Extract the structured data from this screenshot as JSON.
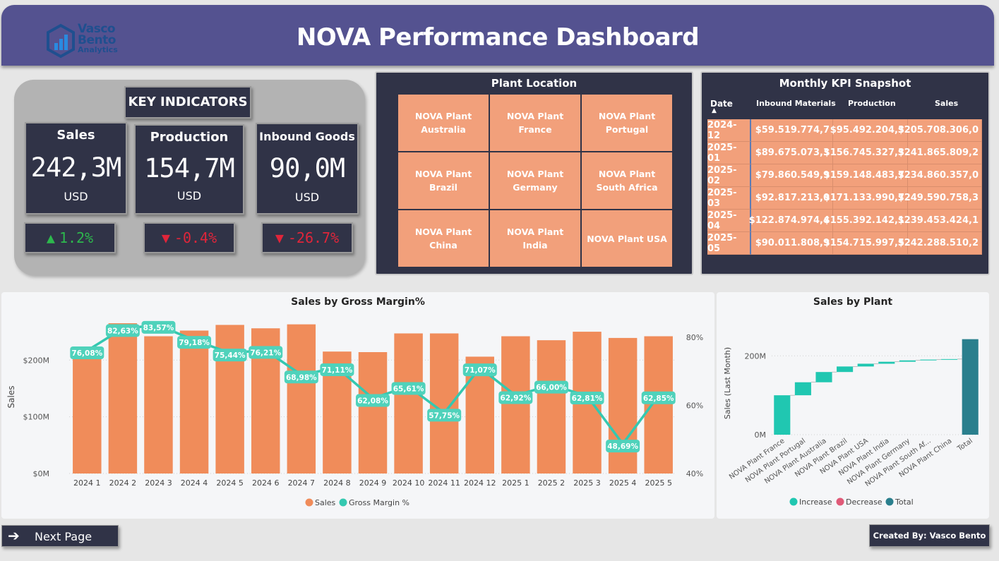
{
  "header": {
    "logo_line1": "Vasco",
    "logo_line2": "Bento",
    "logo_line3": "Analytics",
    "title": "NOVA Performance Dashboard"
  },
  "key_indicators": {
    "title": "KEY INDICATORS",
    "cards": [
      {
        "label": "Sales",
        "value": "242,3M",
        "unit": "USD",
        "delta": "1.2%",
        "direction": "up"
      },
      {
        "label": "Production",
        "value": "154,7M",
        "unit": "USD",
        "delta": "-0.4%",
        "direction": "down"
      },
      {
        "label": "Inbound Goods",
        "value": "90,0M",
        "unit": "USD",
        "delta": "-26.7%",
        "direction": "down"
      }
    ]
  },
  "plant_location": {
    "title": "Plant Location",
    "plants": [
      "NOVA Plant Australia",
      "NOVA Plant France",
      "NOVA Plant Portugal",
      "NOVA Plant Brazil",
      "NOVA Plant Germany",
      "NOVA Plant South Africa",
      "NOVA Plant China",
      "NOVA Plant India",
      "NOVA Plant USA"
    ]
  },
  "kpi_snapshot": {
    "title": "Monthly KPI Snapshot",
    "columns": [
      "Date",
      "Inbound Materials",
      "Production",
      "Sales"
    ],
    "rows": [
      [
        "2024-12",
        "$59.519.774,7",
        "$95.492.204,3",
        "$205.708.306,0"
      ],
      [
        "2025-01",
        "$89.675.073,3",
        "$156.745.327,3",
        "$241.865.809,2"
      ],
      [
        "2025-02",
        "$79.860.549,9",
        "$159.148.483,7",
        "$234.860.357,0"
      ],
      [
        "2025-03",
        "$92.817.213,0",
        "$171.133.990,7",
        "$249.590.758,3"
      ],
      [
        "2025-04",
        "$122.874.974,4",
        "$155.392.142,1",
        "$239.453.424,1"
      ],
      [
        "2025-05",
        "$90.011.808,9",
        "$154.715.997,5",
        "$242.288.510,2"
      ]
    ]
  },
  "colors": {
    "header": "#545290",
    "dark": "#303347",
    "sales_bar": "#f08c5a",
    "margin_line": "#34c8b0",
    "increase": "#20c7b1",
    "decrease": "#e05a78",
    "total": "#2a7f8d"
  },
  "chart_data": [
    {
      "type": "bar",
      "title": "Sales by Gross Margin%",
      "ylabel": "Sales",
      "categories": [
        "2024 1",
        "2024 2",
        "2024 3",
        "2024 4",
        "2024 5",
        "2024 6",
        "2024 7",
        "2024 8",
        "2024 9",
        "2024 10",
        "2024 11",
        "2024 12",
        "2025 1",
        "2025 2",
        "2025 3",
        "2025 4",
        "2025 5"
      ],
      "y_ticks": [
        "$0M",
        "$100M",
        "$200M"
      ],
      "y2_ticks": [
        "40%",
        "60%",
        "80%"
      ],
      "ylim": [
        0,
        270
      ],
      "y2lim": [
        40,
        85
      ],
      "series": [
        {
          "name": "Sales",
          "values": [
            212,
            265,
            242,
            252,
            262,
            256,
            263,
            215,
            214,
            247,
            247,
            206,
            242,
            235,
            250,
            239,
            242
          ]
        },
        {
          "name": "Gross Margin %",
          "values": [
            76.08,
            82.63,
            83.57,
            79.18,
            75.44,
            76.21,
            68.98,
            71.11,
            62.08,
            65.61,
            57.75,
            71.07,
            62.92,
            66.0,
            62.81,
            48.69,
            62.85
          ],
          "labels": [
            "76,08%",
            "82,63%",
            "83,57%",
            "79,18%",
            "75,44%",
            "76,21%",
            "68,98%",
            "71,11%",
            "62,08%",
            "65,61%",
            "57,75%",
            "71,07%",
            "62,92%",
            "66,00%",
            "62,81%",
            "48,69%",
            "62,85%"
          ]
        }
      ],
      "legend": [
        "Sales",
        "Gross Margin %"
      ],
      "legend_position": "bottom"
    },
    {
      "type": "waterfall",
      "title": "Sales by Plant",
      "ylabel": "Sales (Last Month)",
      "y_ticks": [
        "0M",
        "200M"
      ],
      "ylim": [
        0,
        290
      ],
      "categories": [
        "NOVA Plant France",
        "NOVA Plant Portugal",
        "NOVA Plant Australia",
        "NOVA Plant Brazil",
        "NOVA Plant USA",
        "NOVA Plant India",
        "NOVA Plant Germany",
        "NOVA Plant South Af...",
        "NOVA Plant China",
        "Total"
      ],
      "values": [
        100,
        33,
        26,
        14,
        7,
        5,
        3.5,
        2,
        1.3,
        242.3
      ],
      "kinds": [
        "increase",
        "increase",
        "increase",
        "increase",
        "increase",
        "increase",
        "increase",
        "increase",
        "increase",
        "total"
      ],
      "legend": [
        "Increase",
        "Decrease",
        "Total"
      ],
      "legend_position": "bottom"
    }
  ],
  "footer": {
    "next_page": "Next Page",
    "credit": "Created By: Vasco Bento"
  }
}
